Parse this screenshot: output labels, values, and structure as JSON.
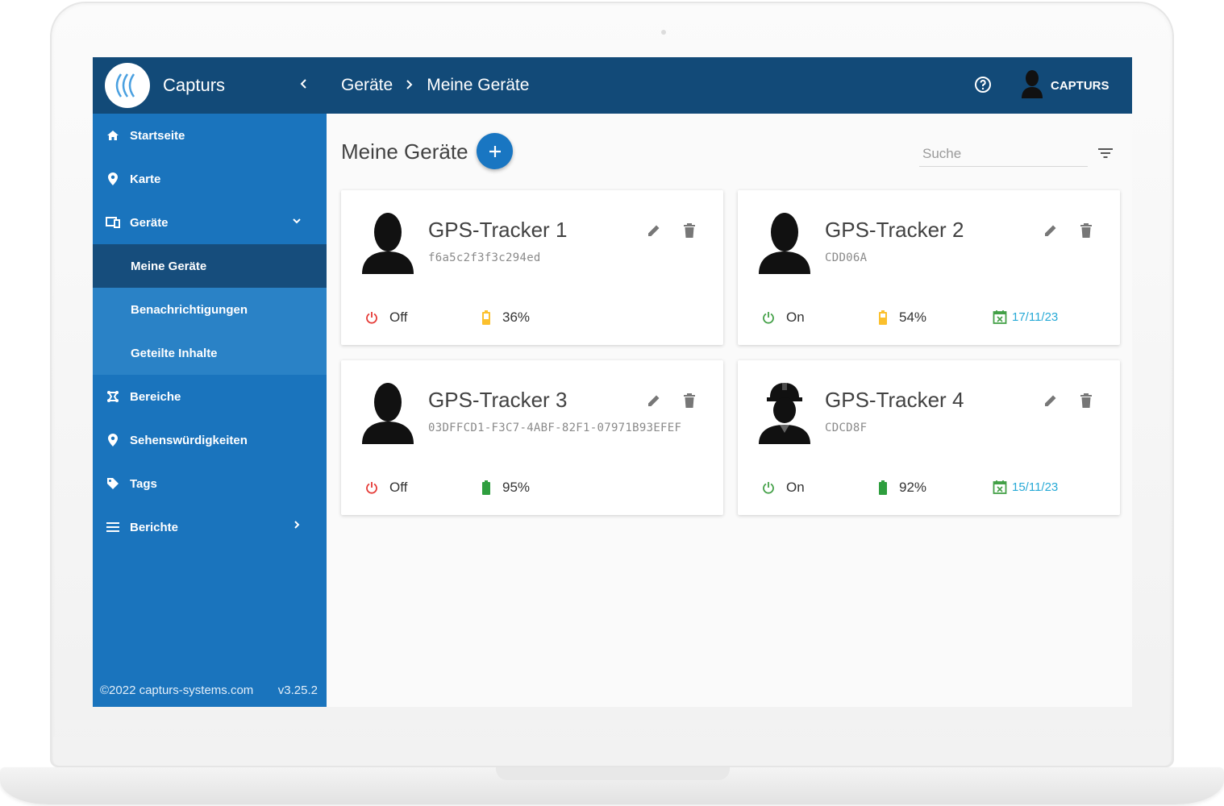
{
  "app": {
    "name": "Capturs"
  },
  "breadcrumb": [
    "Geräte",
    "Meine Geräte"
  ],
  "user": {
    "name": "CAPTURS"
  },
  "sidebar": {
    "items": [
      {
        "label": "Startseite",
        "icon": "home-icon"
      },
      {
        "label": "Karte",
        "icon": "map-pin-icon"
      },
      {
        "label": "Geräte",
        "icon": "devices-icon"
      },
      {
        "label": "Bereiche",
        "icon": "area-icon"
      },
      {
        "label": "Sehenswürdigkeiten",
        "icon": "map-pin-icon"
      },
      {
        "label": "Tags",
        "icon": "tag-icon"
      },
      {
        "label": "Berichte",
        "icon": "list-icon"
      }
    ],
    "sub_items": [
      {
        "label": "Meine Geräte",
        "active": true
      },
      {
        "label": "Benachrichtigungen",
        "active": false
      },
      {
        "label": "Geteilte Inhalte",
        "active": false
      }
    ],
    "footer": {
      "copyright": "©2022 capturs-systems.com",
      "version": "v3.25.2"
    }
  },
  "main": {
    "title": "Meine Geräte",
    "search_placeholder": "Suche",
    "devices": [
      {
        "name": "GPS-Tracker 1",
        "id": "f6a5c2f3f3c294ed",
        "power": "Off",
        "battery": "36%",
        "date": "",
        "avatar": "person-icon"
      },
      {
        "name": "GPS-Tracker 2",
        "id": "CDD06A",
        "power": "On",
        "battery": "54%",
        "date": "17/11/23",
        "avatar": "person-icon"
      },
      {
        "name": "GPS-Tracker 3",
        "id": "03DFFCD1-F3C7-4ABF-82F1-07971B93EFEF",
        "power": "Off",
        "battery": "95%",
        "date": "",
        "avatar": "person-icon"
      },
      {
        "name": "GPS-Tracker 4",
        "id": "CDCD8F",
        "power": "On",
        "battery": "92%",
        "date": "15/11/23",
        "avatar": "worker-icon"
      }
    ]
  },
  "colors": {
    "sidebar": "#1a74bd",
    "topbar": "#124a78",
    "active_item": "#164d7c",
    "accent": "#1976c2",
    "power_off": "#e53935",
    "power_on": "#43a047",
    "battery_mid": "#fbc02d",
    "battery_full": "#2e9e3e",
    "date": "#26a9d6"
  }
}
